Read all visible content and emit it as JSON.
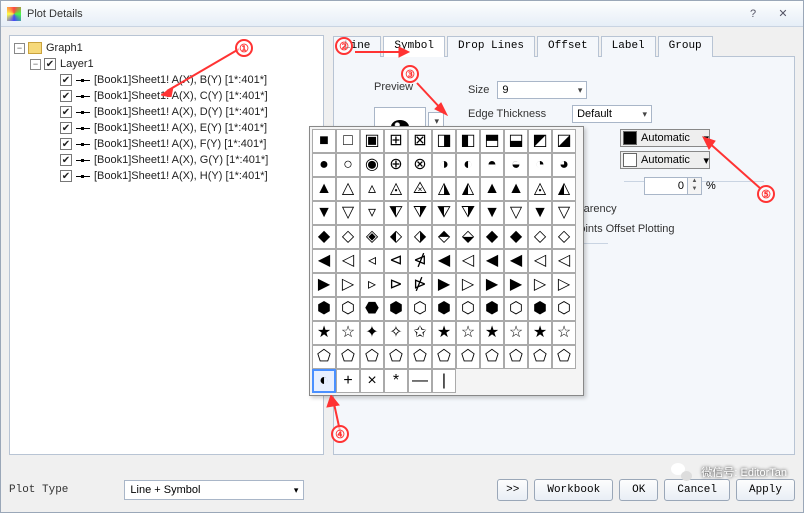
{
  "window": {
    "title": "Plot Details"
  },
  "tree": {
    "root": {
      "label": "Graph1"
    },
    "layer": {
      "label": "Layer1"
    },
    "plots": [
      "[Book1]Sheet1! A(X), B(Y) [1*:401*]",
      "[Book1]Sheet1! A(X), C(Y) [1*:401*]",
      "[Book1]Sheet1! A(X), D(Y) [1*:401*]",
      "[Book1]Sheet1! A(X), E(Y) [1*:401*]",
      "[Book1]Sheet1! A(X), F(Y) [1*:401*]",
      "[Book1]Sheet1! A(X), G(Y) [1*:401*]",
      "[Book1]Sheet1! A(X), H(Y) [1*:401*]"
    ]
  },
  "tabs": [
    "Line",
    "Symbol",
    "Drop Lines",
    "Offset",
    "Label",
    "Group"
  ],
  "active_tab": "Symbol",
  "symbol_panel": {
    "preview_label": "Preview",
    "size_label": "Size",
    "size_value": "9",
    "edge_label": "Edge Thickness",
    "edge_value": "Default",
    "color_label": "Automatic",
    "edgecolor_label": "Automatic",
    "transparency_label": "sparency",
    "transparency_value": "0",
    "transparency_unit": "%",
    "offset_label": "Points Offset Plotting"
  },
  "bottom": {
    "plot_type_label": "Plot Type",
    "plot_type_value": "Line + Symbol",
    "nav": ">>",
    "workbook": "Workbook",
    "ok": "OK",
    "cancel": "Cancel",
    "apply": "Apply"
  },
  "callouts": {
    "c1": "①",
    "c2": "②",
    "c3": "③",
    "c4": "④",
    "c5": "⑤"
  },
  "watermark": {
    "text": "微信号: EditorTan"
  },
  "gallery_symbols": [
    "■",
    "□",
    "▣",
    "⊞",
    "⊠",
    "◨",
    "◧",
    "⬒",
    "⬓",
    "◩",
    "◪",
    "●",
    "○",
    "◉",
    "⊕",
    "⊗",
    "◑",
    "◐",
    "◓",
    "◒",
    "◔",
    "◕",
    "▲",
    "△",
    "▵",
    "◬",
    "⨻",
    "◮",
    "◭",
    "▲",
    "▲",
    "◬",
    "◭",
    "▼",
    "▽",
    "▿",
    "⧨",
    "⧩",
    "⧨",
    "⧩",
    "▼",
    "▽",
    "▼",
    "▽",
    "◆",
    "◇",
    "◈",
    "⬖",
    "⬗",
    "⬘",
    "⬙",
    "◆",
    "◆",
    "◇",
    "◇",
    "◀",
    "◁",
    "◃",
    "⊲",
    "⋪",
    "◀",
    "◁",
    "◀",
    "◀",
    "◁",
    "◁",
    "▶",
    "▷",
    "▹",
    "⊳",
    "⋫",
    "▶",
    "▷",
    "▶",
    "▶",
    "▷",
    "▷",
    "⬢",
    "⬡",
    "⬣",
    "⬢",
    "⬡",
    "⬢",
    "⬡",
    "⬢",
    "⬡",
    "⬢",
    "⬡",
    "★",
    "☆",
    "✦",
    "✧",
    "✩",
    "★",
    "☆",
    "★",
    "☆",
    "★",
    "☆",
    "⬠",
    "⬠",
    "⬠",
    "⬠",
    "⬠",
    "⬠",
    "⬠",
    "⬠",
    "⬠",
    "⬠",
    "⬠",
    "◐",
    "+",
    "×",
    "*",
    "—",
    "|"
  ]
}
